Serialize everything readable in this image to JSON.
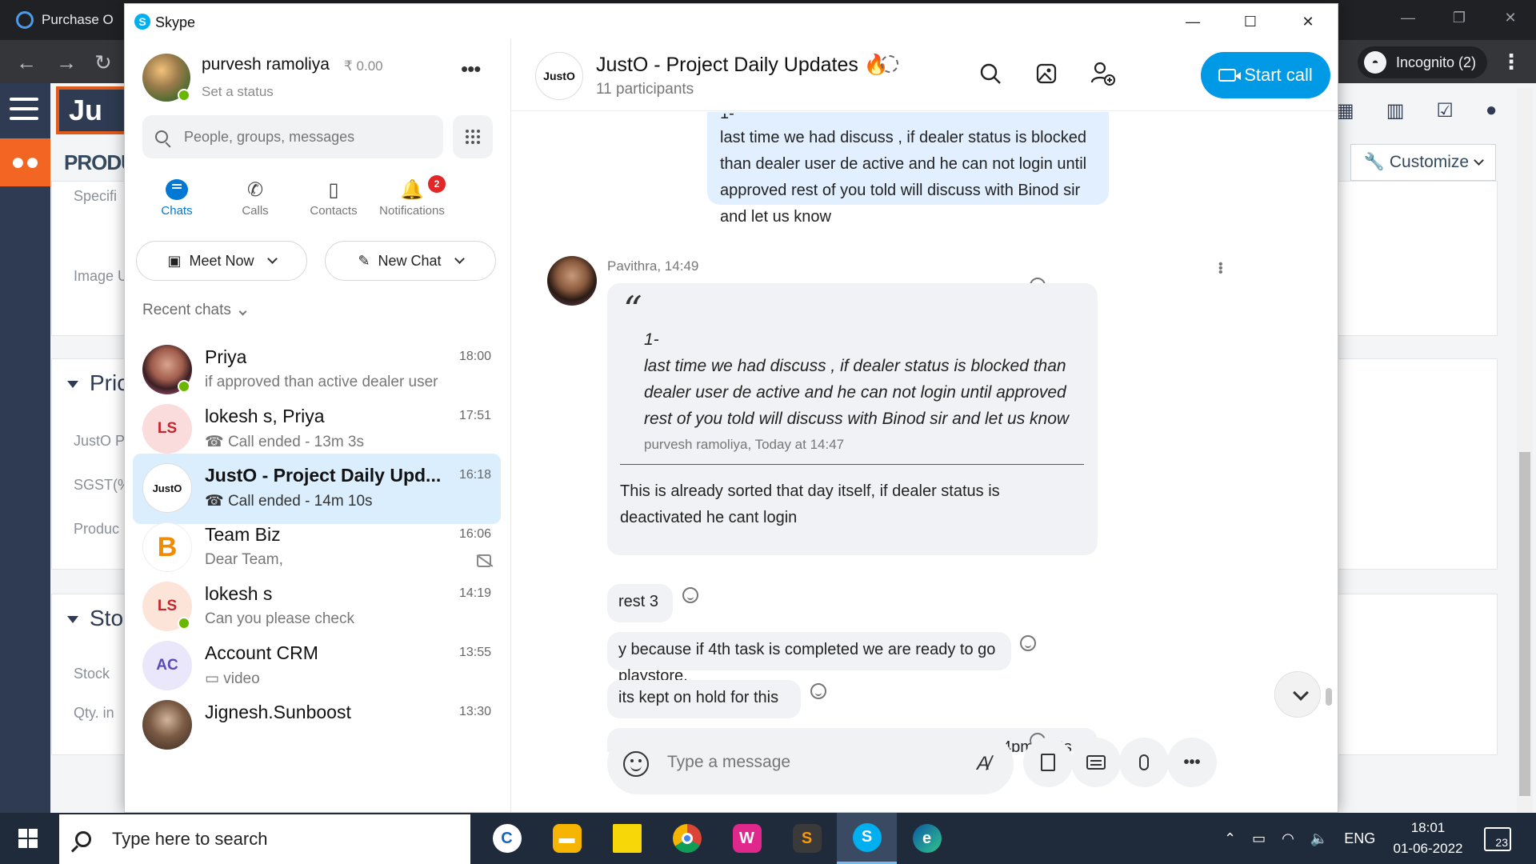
{
  "browser": {
    "tab_title": "Purchase O",
    "incognito_label": "Incognito (2)"
  },
  "background_app": {
    "logo_text": "Ju",
    "module_title": "PRODUC",
    "fields": {
      "specific": "Specifi",
      "image": "Image U",
      "justo": "JustO P",
      "sgst": "SGST(%",
      "product": "Produc",
      "stock": "Stock",
      "qty": "Qty. in"
    },
    "sections": {
      "pricing": "Pric",
      "stock": "Sto"
    },
    "customize_label": "Customize"
  },
  "skype": {
    "app_title": "Skype",
    "profile": {
      "name": "purvesh ramoliya",
      "balance": "₹ 0.00",
      "status": "Set a status"
    },
    "search_placeholder": "People, groups, messages",
    "nav": {
      "chats": "Chats",
      "calls": "Calls",
      "contacts": "Contacts",
      "notifications": "Notifications",
      "notifications_count": "2"
    },
    "meet_now": "Meet Now",
    "new_chat": "New Chat",
    "recent_label": "Recent chats",
    "chats": [
      {
        "name": "Priya",
        "preview": "if approved than active dealer user",
        "time": "18:00"
      },
      {
        "name": "lokesh s, Priya",
        "initials": "LS",
        "preview": "Call ended - 13m 3s",
        "time": "17:51"
      },
      {
        "name": "JustO - Project Daily Upd...",
        "preview": "Call ended - 14m 10s",
        "time": "16:18"
      },
      {
        "name": "Team Biz",
        "preview": "Dear Team,",
        "time": "16:06"
      },
      {
        "name": "lokesh s",
        "initials": "LS",
        "preview": "Can you please check",
        "time": "14:19"
      },
      {
        "name": "Account CRM",
        "initials": "AC",
        "preview": "video",
        "time": "13:55"
      },
      {
        "name": "Jignesh.Sunboost",
        "preview": "",
        "time": "13:30"
      }
    ],
    "conversation": {
      "avatar_text": "JustO",
      "title": "JustO - Project Daily Updates",
      "title_emoji": "🔥",
      "participants": "11 participants",
      "start_call": "Start call",
      "own_message": {
        "line0": "1-",
        "text": "last time we had discuss , if dealer status is blocked than dealer user de active and he can not login until approved rest of you told will discuss with Binod  sir and let us know"
      },
      "sender_line": "Pavithra, 14:49",
      "quote": {
        "mark": "“",
        "line0": "1-",
        "text": "last time we had discuss , if dealer status is blocked than dealer user de active and he can not login until approved rest of you told will discuss with Binod  sir and let us know",
        "author": "purvesh ramoliya, Today at 14:47"
      },
      "reply": "This is already sorted that day itself, if dealer status is deactivated he cant login",
      "messages": [
        "rest 3",
        "y because if 4th task is completed we are ready to go playstore.",
        "its kept on hold for this",
        "Kindly make urself free for sometime between 3pm to 4pm , lets take a final call about this and finalize"
      ],
      "composer_placeholder": "Type a message"
    }
  },
  "taskbar": {
    "search_placeholder": "Type here to search",
    "language": "ENG",
    "time": "18:01",
    "date": "01-06-2022",
    "notification_count": "23"
  }
}
